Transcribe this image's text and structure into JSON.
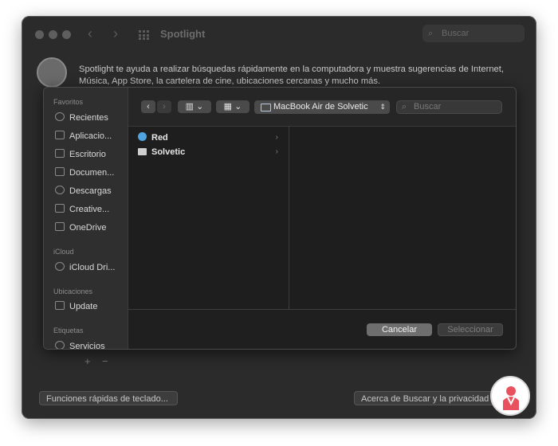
{
  "window": {
    "title": "Spotlight",
    "search_placeholder": "Buscar",
    "description": "Spotlight te ayuda a realizar búsquedas rápidamente en la computadora y muestra sugerencias de Internet, Música, App Store, la cartelera de cine, ubicaciones cercanas y mucho más.",
    "plus_label": "+",
    "minus_label": "−",
    "shortcuts_button": "Funciones rápidas de teclado...",
    "privacy_button": "Acerca de Buscar y la privacidad"
  },
  "dialog": {
    "sidebar": {
      "sections": [
        {
          "heading": "Favoritos",
          "items": [
            "Recientes",
            "Aplicacio...",
            "Escritorio",
            "Documen...",
            "Descargas",
            "Creative...",
            "OneDrive"
          ]
        },
        {
          "heading": "iCloud",
          "items": [
            "iCloud Dri..."
          ]
        },
        {
          "heading": "Ubicaciones",
          "items": [
            "Update"
          ]
        },
        {
          "heading": "Etiquetas",
          "items": [
            "Servicios"
          ]
        }
      ]
    },
    "toolbar": {
      "back_icon": "chevron-left-icon",
      "forward_icon": "chevron-right-icon",
      "view_icon": "columns-view-icon",
      "group_icon": "grid-icon",
      "location": "MacBook Air de Solvetic",
      "search_placeholder": "Buscar"
    },
    "column1": [
      {
        "label": "Red",
        "icon": "network-icon"
      },
      {
        "label": "Solvetic",
        "icon": "disk-icon"
      }
    ],
    "cancel_button": "Cancelar",
    "select_button": "Seleccionar"
  }
}
